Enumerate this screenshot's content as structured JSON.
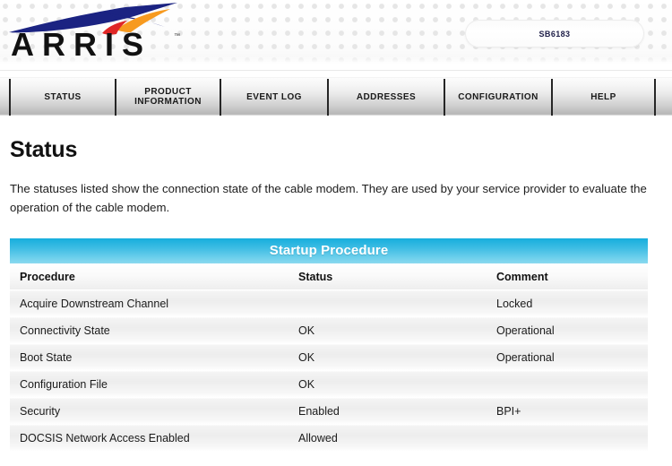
{
  "brand": {
    "name": "ARRIS",
    "trademark": "™",
    "logo_icon": "arris-swoosh-logo",
    "colors": {
      "swoosh_blue": "#1b2382",
      "swoosh_orange": "#f79a1f",
      "swoosh_red": "#e02726"
    }
  },
  "header": {
    "model_number": "SB6183"
  },
  "nav": {
    "items": [
      {
        "label": "STATUS",
        "name": "nav-item-status"
      },
      {
        "label": "PRODUCT INFORMATION",
        "name": "nav-item-product-information"
      },
      {
        "label": "EVENT LOG",
        "name": "nav-item-event-log"
      },
      {
        "label": "ADDRESSES",
        "name": "nav-item-addresses"
      },
      {
        "label": "CONFIGURATION",
        "name": "nav-item-configuration"
      },
      {
        "label": "HELP",
        "name": "nav-item-help"
      }
    ]
  },
  "main": {
    "title": "Status",
    "description": "The statuses listed show the connection state of the cable modem. They are used by your service provider to evaluate the operation of the cable modem."
  },
  "table": {
    "title": "Startup Procedure",
    "accent_color": "#16aedd",
    "columns": [
      "Procedure",
      "Status",
      "Comment"
    ],
    "rows": [
      {
        "procedure": "Acquire Downstream Channel",
        "status": "",
        "comment": "Locked"
      },
      {
        "procedure": "Connectivity State",
        "status": "OK",
        "comment": "Operational"
      },
      {
        "procedure": "Boot State",
        "status": "OK",
        "comment": "Operational"
      },
      {
        "procedure": "Configuration File",
        "status": "OK",
        "comment": ""
      },
      {
        "procedure": "Security",
        "status": "Enabled",
        "comment": "BPI+"
      },
      {
        "procedure": "DOCSIS Network Access Enabled",
        "status": "Allowed",
        "comment": ""
      }
    ]
  }
}
